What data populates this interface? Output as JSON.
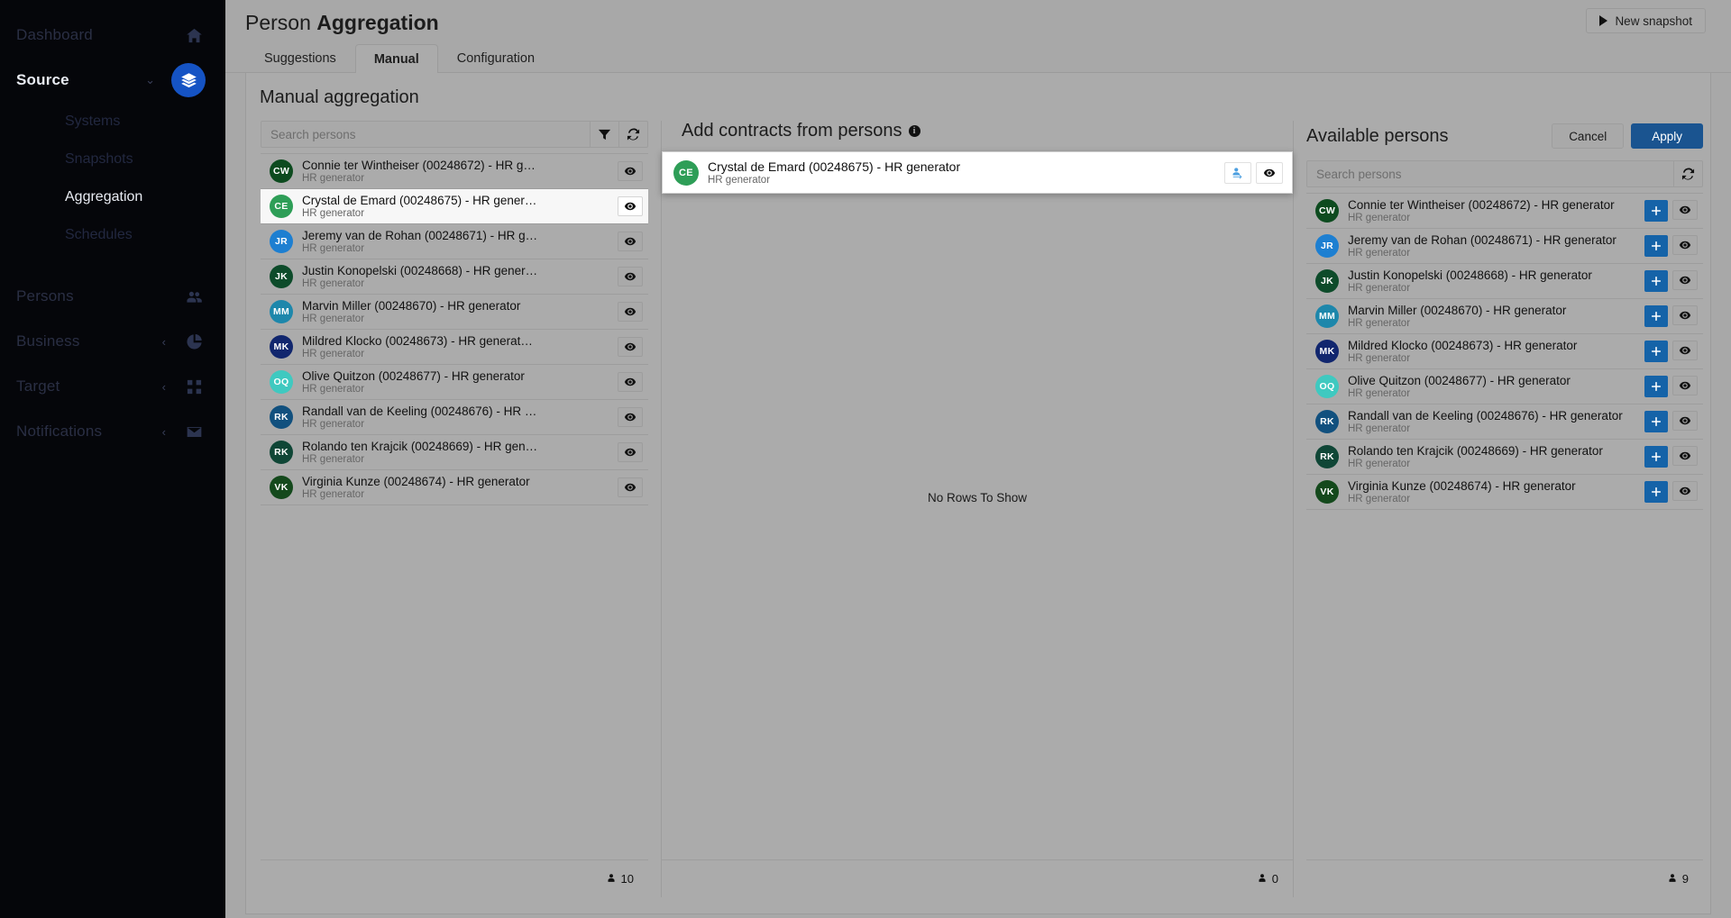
{
  "sidebar": {
    "items": [
      {
        "label": "Dashboard",
        "icon": "home-icon",
        "type": "group",
        "active": false
      },
      {
        "label": "Source",
        "icon": "layers-icon",
        "type": "group",
        "active": true,
        "chevron": "⌄"
      },
      {
        "label": "Systems",
        "type": "sub",
        "active": false
      },
      {
        "label": "Snapshots",
        "type": "sub",
        "active": false
      },
      {
        "label": "Aggregation",
        "type": "sub",
        "active": true
      },
      {
        "label": "Schedules",
        "type": "sub",
        "active": false
      },
      {
        "label": "Persons",
        "icon": "people-icon",
        "type": "group",
        "active": false
      },
      {
        "label": "Business",
        "icon": "chart-pie-icon",
        "type": "group",
        "active": false,
        "chevron": "‹"
      },
      {
        "label": "Target",
        "icon": "grid-icon",
        "type": "group",
        "active": false,
        "chevron": "‹"
      },
      {
        "label": "Notifications",
        "icon": "envelope-icon",
        "type": "group",
        "active": false,
        "chevron": "‹"
      }
    ]
  },
  "header": {
    "title_prefix": "Person ",
    "title_bold": "Aggregation",
    "new_snapshot_label": "New snapshot"
  },
  "tabs": [
    {
      "label": "Suggestions",
      "selected": false
    },
    {
      "label": "Manual",
      "selected": true
    },
    {
      "label": "Configuration",
      "selected": false
    }
  ],
  "card": {
    "title": "Manual aggregation"
  },
  "left_panel": {
    "search_placeholder": "Search persons",
    "search_value": "",
    "filter_icon": "filter-icon",
    "refresh_icon": "refresh-icon",
    "footer_count": "10",
    "rows": [
      {
        "initials": "CW",
        "color": "#0d4b1f",
        "name": "Connie ter Wintheiser (00248672) - HR g…",
        "sub": "HR generator",
        "selected": false
      },
      {
        "initials": "CE",
        "color": "#2e9e57",
        "name": "Crystal de Emard (00248675) - HR gener…",
        "sub": "HR generator",
        "selected": true
      },
      {
        "initials": "JR",
        "color": "#1d7fd1",
        "name": "Jeremy van de Rohan (00248671) - HR g…",
        "sub": "HR generator",
        "selected": false
      },
      {
        "initials": "JK",
        "color": "#0d4b2a",
        "name": "Justin Konopelski (00248668) - HR gener…",
        "sub": "HR generator",
        "selected": false
      },
      {
        "initials": "MM",
        "color": "#1d87ab",
        "name": "Marvin Miller (00248670) - HR generator",
        "sub": "HR generator",
        "selected": false
      },
      {
        "initials": "MK",
        "color": "#11266e",
        "name": "Mildred Klocko (00248673) - HR generat…",
        "sub": "HR generator",
        "selected": false
      },
      {
        "initials": "OQ",
        "color": "#3fc9c0",
        "name": "Olive Quitzon (00248677) - HR generator",
        "sub": "HR generator",
        "selected": false
      },
      {
        "initials": "RK",
        "color": "#11507e",
        "name": "Randall van de Keeling (00248676) - HR …",
        "sub": "HR generator",
        "selected": false
      },
      {
        "initials": "RK",
        "color": "#0f4636",
        "name": "Rolando ten Krajcik (00248669) - HR gen…",
        "sub": "HR generator",
        "selected": false
      },
      {
        "initials": "VK",
        "color": "#14491c",
        "name": "Virginia Kunze (00248674) - HR generator",
        "sub": "HR generator",
        "selected": false
      }
    ]
  },
  "mid_panel": {
    "title": "Add contracts from persons",
    "info_icon": "info-icon",
    "info_glyph": "i",
    "empty_text": "No Rows To Show",
    "footer_count": "0",
    "overlay": {
      "initials": "CE",
      "color": "#2e9e57",
      "name": "Crystal de Emard (00248675) - HR generator",
      "sub": "HR generator",
      "add_person_icon": "add-person-icon",
      "eye_icon": "eye-icon"
    }
  },
  "right_panel": {
    "title": "Available persons",
    "cancel_label": "Cancel",
    "apply_label": "Apply",
    "apply_color": "#1a5490",
    "search_placeholder": "Search persons",
    "search_value": "",
    "refresh_icon": "refresh-icon",
    "footer_count": "9",
    "rows": [
      {
        "initials": "CW",
        "color": "#0d4b1f",
        "name": "Connie ter Wintheiser (00248672) - HR generator",
        "sub": "HR generator"
      },
      {
        "initials": "JR",
        "color": "#1d7fd1",
        "name": "Jeremy van de Rohan (00248671) - HR generator",
        "sub": "HR generator"
      },
      {
        "initials": "JK",
        "color": "#0d4b2a",
        "name": "Justin Konopelski (00248668) - HR generator",
        "sub": "HR generator"
      },
      {
        "initials": "MM",
        "color": "#1d87ab",
        "name": "Marvin Miller (00248670) - HR generator",
        "sub": "HR generator"
      },
      {
        "initials": "MK",
        "color": "#11266e",
        "name": "Mildred Klocko (00248673) - HR generator",
        "sub": "HR generator"
      },
      {
        "initials": "OQ",
        "color": "#3fc9c0",
        "name": "Olive Quitzon (00248677) - HR generator",
        "sub": "HR generator"
      },
      {
        "initials": "RK",
        "color": "#11507e",
        "name": "Randall van de Keeling (00248676) - HR generator",
        "sub": "HR generator"
      },
      {
        "initials": "RK",
        "color": "#0f4636",
        "name": "Rolando ten Krajcik (00248669) - HR generator",
        "sub": "HR generator"
      },
      {
        "initials": "VK",
        "color": "#14491c",
        "name": "Virginia Kunze (00248674) - HR generator",
        "sub": "HR generator"
      }
    ]
  }
}
